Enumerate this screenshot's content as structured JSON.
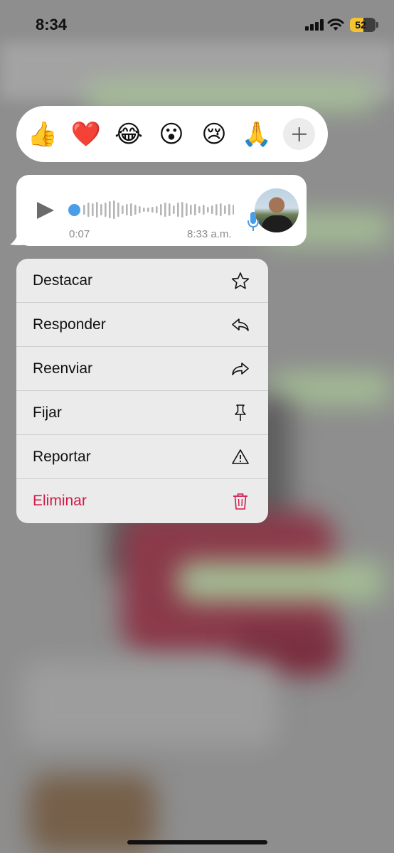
{
  "status_bar": {
    "time": "8:34",
    "battery_level": "52",
    "battery_color": "#f4c430",
    "icons": [
      "signal-icon",
      "wifi-icon",
      "battery-icon"
    ]
  },
  "reactions": {
    "emojis": [
      "👍",
      "❤️",
      "😂",
      "😮",
      "😢",
      "🙏"
    ],
    "add_icon": "plus-icon"
  },
  "message": {
    "type": "voice-note",
    "duration": "0:07",
    "time": "8:33 a.m.",
    "played_fraction": 0,
    "accent": "#4a9ee8",
    "icons": [
      "play-icon",
      "microphone-icon"
    ]
  },
  "menu": {
    "items": [
      {
        "label": "Destacar",
        "icon": "star-icon"
      },
      {
        "label": "Responder",
        "icon": "reply-icon"
      },
      {
        "label": "Reenviar",
        "icon": "forward-icon"
      },
      {
        "label": "Fijar",
        "icon": "pin-icon"
      },
      {
        "label": "Reportar",
        "icon": "warning-icon"
      },
      {
        "label": "Eliminar",
        "icon": "trash-icon",
        "color": "#d11a4a"
      }
    ]
  }
}
